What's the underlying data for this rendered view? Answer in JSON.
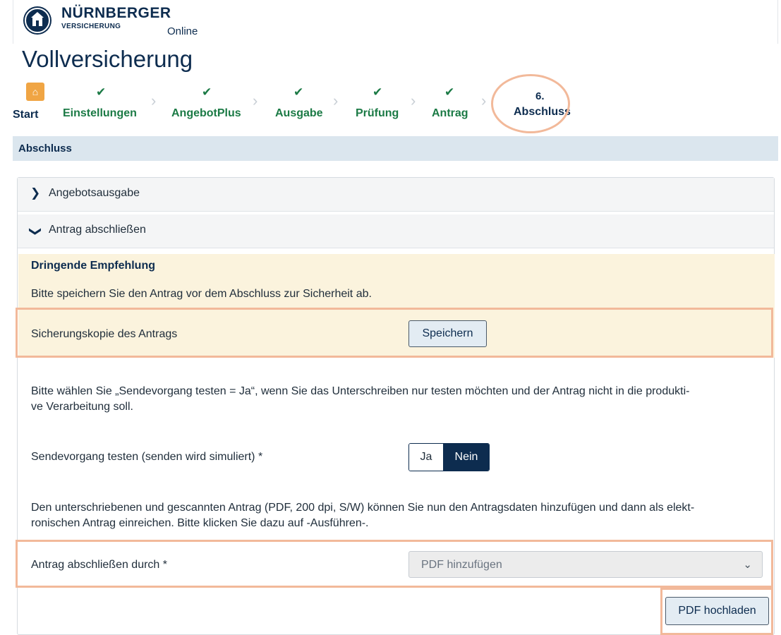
{
  "header": {
    "brand": "NÜRNBERGER",
    "brand_sub": "VERSICHERUNG",
    "online": "Online"
  },
  "page_title": "Vollversicherung",
  "stepper": {
    "start": "Start",
    "steps": [
      {
        "label": "Einstellungen",
        "done": true
      },
      {
        "label": "AngebotPlus",
        "done": true
      },
      {
        "label": "Ausgabe",
        "done": true
      },
      {
        "label": "Prüfung",
        "done": true
      },
      {
        "label": "Antrag",
        "done": true
      }
    ],
    "active_number": "6.",
    "active_label": "Abschluss"
  },
  "section_title": "Abschluss",
  "accordion": {
    "item1": "Angebotsausgabe",
    "item2": "Antrag abschließen"
  },
  "notice": {
    "heading": "Dringende Empfehlung",
    "text": "Bitte speichern Sie den Antrag vor dem Abschluss zur Sicherheit ab."
  },
  "backup": {
    "label": "Sicherungskopie des Antrags",
    "button": "Speichern"
  },
  "test_hint_line1": "Bitte wählen Sie „Sendevorgang testen = Ja“, wenn Sie das Unterschreiben nur testen möchten und der Antrag nicht in die produkti-",
  "test_hint_line2": "ve Verarbeitung soll.",
  "test_send": {
    "label": "Sendevorgang testen (senden wird simuliert) *",
    "yes": "Ja",
    "no": "Nein",
    "selected": "Nein"
  },
  "upload_hint_line1": "Den unterschriebenen und gescannten Antrag (PDF, 200 dpi, S/W) können Sie nun den Antragsdaten hinzufügen und dann als elekt-",
  "upload_hint_line2": "ronischen Antrag einreichen. Bitte klicken Sie dazu auf -Ausführen-.",
  "complete_by": {
    "label": "Antrag abschließen durch *",
    "selected": "PDF hinzufügen"
  },
  "upload_button": "PDF hochladen",
  "colors": {
    "brand_navy": "#0d2c4f",
    "step_green": "#1b7a45",
    "home_orange": "#f0a544",
    "highlight_peach": "#f2b99a",
    "notice_bg": "#fbf3dd"
  }
}
